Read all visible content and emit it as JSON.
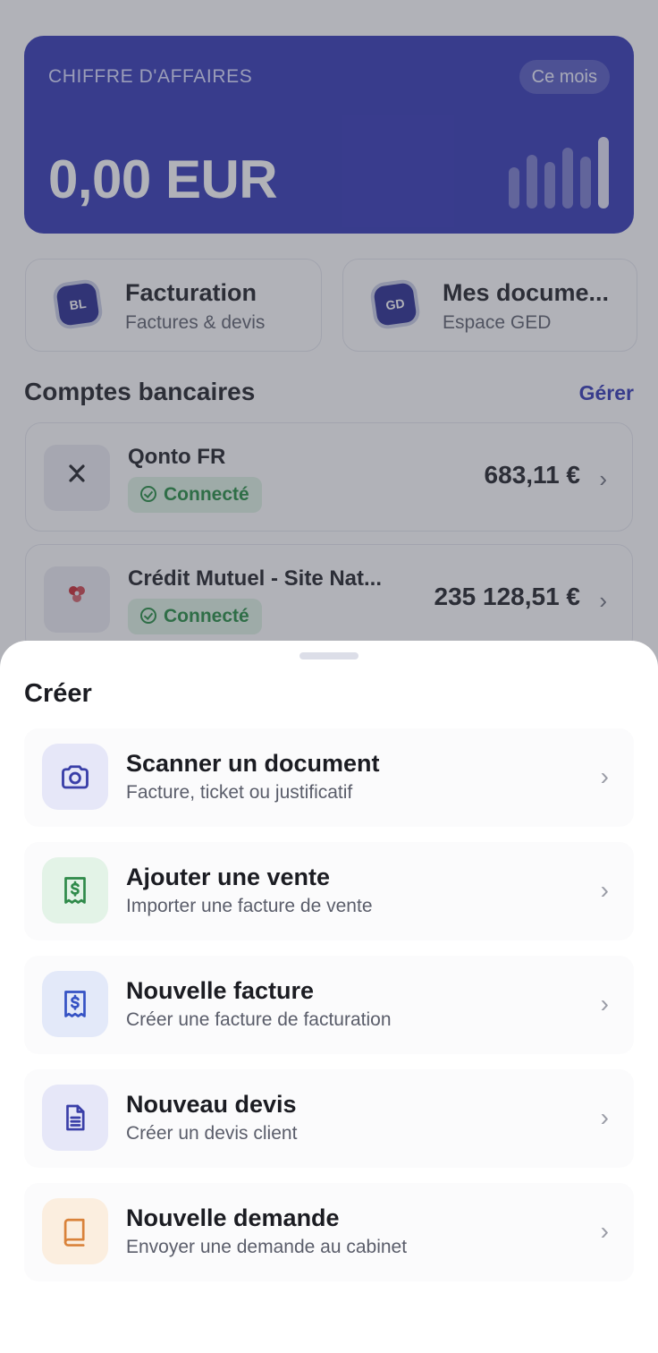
{
  "revenue": {
    "label": "CHIFFRE D'AFFAIRES",
    "period": "Ce mois",
    "amount": "0,00 EUR"
  },
  "shortcuts": [
    {
      "logo": "BL",
      "title": "Facturation",
      "subtitle": "Factures & devis"
    },
    {
      "logo": "GD",
      "title": "Mes docume...",
      "subtitle": "Espace GED"
    }
  ],
  "bank_section": {
    "title": "Comptes bancaires",
    "manage": "Gérer",
    "accounts": [
      {
        "name": "Qonto FR",
        "status": "Connecté",
        "balance": "683,11 €",
        "logo": "qonto-logo"
      },
      {
        "name": "Crédit Mutuel - Site Nat...",
        "status": "Connecté",
        "balance": "235 128,51 €",
        "logo": "credit-mutuel-logo"
      }
    ]
  },
  "sheet": {
    "title": "Créer",
    "actions": [
      {
        "title": "Scanner un document",
        "subtitle": "Facture, ticket ou justificatif",
        "icon": "camera-icon",
        "color": "#3a3fa8",
        "bg": "#e6e7f8"
      },
      {
        "title": "Ajouter une vente",
        "subtitle": "Importer une facture de vente",
        "icon": "receipt-dollar-icon",
        "color": "#2f8a4a",
        "bg": "#e3f3e7"
      },
      {
        "title": "Nouvelle facture",
        "subtitle": "Créer une facture de facturation",
        "icon": "receipt-dollar-icon",
        "color": "#3552c4",
        "bg": "#e3e9f9"
      },
      {
        "title": "Nouveau devis",
        "subtitle": "Créer un devis client",
        "icon": "document-icon",
        "color": "#3a3fa8",
        "bg": "#e6e7f8"
      },
      {
        "title": "Nouvelle demande",
        "subtitle": "Envoyer une demande au cabinet",
        "icon": "book-icon",
        "color": "#d9823a",
        "bg": "#fbeedf"
      }
    ]
  }
}
